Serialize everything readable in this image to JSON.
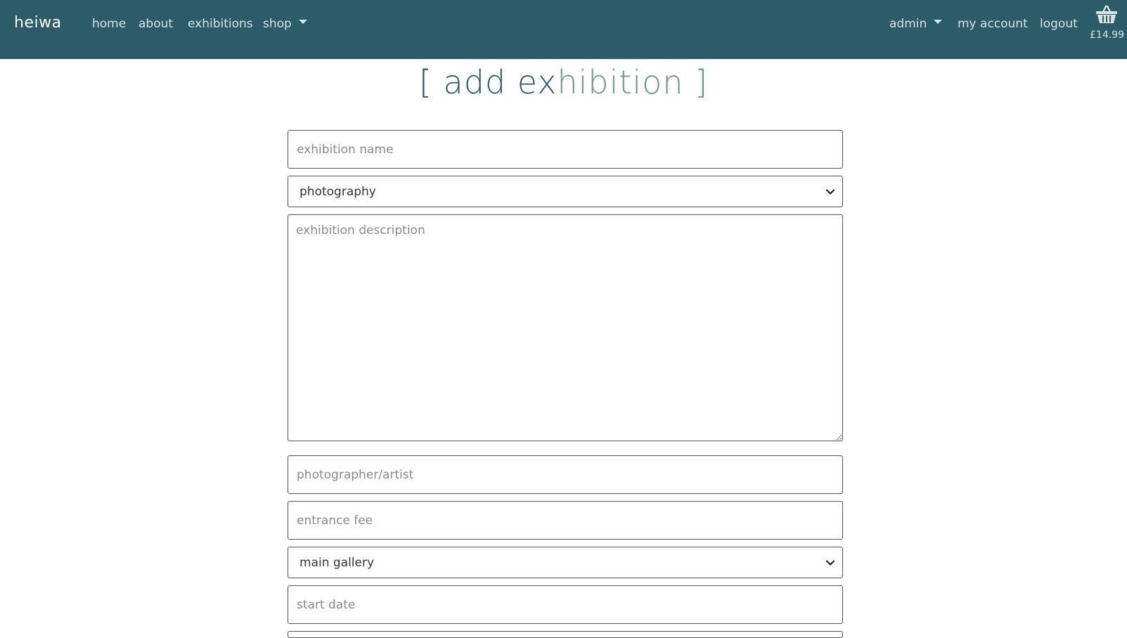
{
  "navbar": {
    "brand": "heiwa",
    "left_links": [
      "home",
      "about",
      "exhibitions",
      "shop"
    ],
    "right_links": [
      "admin",
      "my account",
      "logout"
    ],
    "basket_total": "£14.99",
    "basket_icon": "basket-icon",
    "background": "#2c5c6a"
  },
  "page": {
    "title_open": "[",
    "title_main_a": "add ex",
    "title_main_b": "hibition",
    "title_close": "]"
  },
  "form": {
    "name_placeholder": "exhibition name",
    "category_value": "photography",
    "description_placeholder": "exhibition description",
    "artist_placeholder": "photographer/artist",
    "fee_placeholder": "entrance fee",
    "gallery_value": "main gallery",
    "start_date_placeholder": "start date"
  }
}
